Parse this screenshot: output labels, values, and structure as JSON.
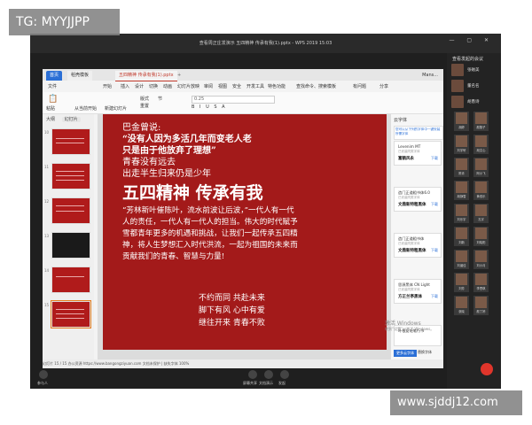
{
  "window": {
    "title": "查看周正庄发演示 五四精神 传承有我(1).pptx - WPS 2019 15:03"
  },
  "wps": {
    "tabs": [
      "首页",
      "稻壳模板",
      "五四精神 传承有我(1).pptx",
      "+"
    ],
    "top_right": "Mans...",
    "menus": [
      "文件",
      "开始",
      "插入",
      "设计",
      "切换",
      "动画",
      "幻灯片放映",
      "审阅",
      "视图",
      "安全",
      "开发工具",
      "特色功能",
      "查找命令、搜索模板",
      "有问题",
      "分享"
    ],
    "font_size": "0.25",
    "toolbar_items": [
      "粘贴",
      "从当前开始",
      "新建幻灯片",
      "版式",
      "重置",
      "节"
    ],
    "thumb_header": {
      "left": "大纲",
      "pill": "幻灯片"
    },
    "thumb_numbers": [
      "10",
      "11",
      "12",
      "13",
      "14",
      "15"
    ],
    "status": "幻灯片 15 / 15    办公资源 https://www.bangongziyuan.com        文档未保护  |  缺失字体                                           100%"
  },
  "slide": {
    "lines": [
      "巴金曾说:",
      "“没有人因为多活几年而变老人老",
      "只是由于他放弃了理想”",
      "青春没有远去",
      "出走半生归来仍是少年",
      "五四精神 传承有我",
      "“芳林新叶催陈叶，流水前波让后波，”一代人有一代",
      "人的责任，一代人有一代人的担当。伟大的时代赋予",
      "雪都青年更多的机遇和挑战，让我们一起传承五四精",
      "神，将人生梦想汇入时代洪流，一起为祖国的未来而",
      "贡献我们的青春、智慧与力量!",
      "不约而同 共赴未来",
      "脚下有风 心中有爱",
      "继往开来 青春不败"
    ]
  },
  "font_panel": {
    "title": "云字体",
    "banner": "您可以从下列的字体中一键安装所需字体",
    "cards": [
      {
        "name": "Levenim MT",
        "sub": "已安装同类字体",
        "preview": "富鹤风永",
        "action": "下载"
      },
      {
        "name": "造门正道粗书体6.0",
        "sub": "已安装同类字体",
        "preview": "文鼎新特粗黑体",
        "action": "下载"
      },
      {
        "name": "造门正道粗书体",
        "sub": "已安装同类字体",
        "preview": "文鼎新特粗黑体",
        "action": "下载"
      },
      {
        "name": "思源黑体 CN Light",
        "sub": "已安装同类字体",
        "preview": "方正兰亭黑体",
        "action": "下载"
      },
      {
        "name": "叶根友毛笔行书",
        "sub": "",
        "preview": "",
        "action": ""
      }
    ],
    "button": "更多云字体",
    "link": "替换字体"
  },
  "right_panel": {
    "title": "查看发起的会议",
    "users": [
      "张磁美",
      "董名名",
      "胡愚诗"
    ],
    "grid": [
      "胡婷",
      "颜翔子",
      "刘宇轩",
      "胡文心",
      "陈青",
      "阿小飞",
      "胡静雪",
      "黄双乐",
      "刘乐宇",
      "孔宇",
      "刘新",
      "刘晓阳",
      "刘涵佳",
      "刘小月",
      "刘芳",
      "李思琪",
      "张晓",
      "颜丁婷"
    ]
  },
  "bottom": {
    "left_label": "参与人",
    "buttons": [
      "屏幕共享",
      "文档演示",
      "发起"
    ],
    "end_label": "结束"
  },
  "activation": {
    "line1": "激活 Windows",
    "line2": "转到“设置”以激活 Windows。"
  },
  "watermarks": {
    "top_left": "TG: MYYJJPP",
    "bottom_right": "www.sjddj12.com"
  }
}
